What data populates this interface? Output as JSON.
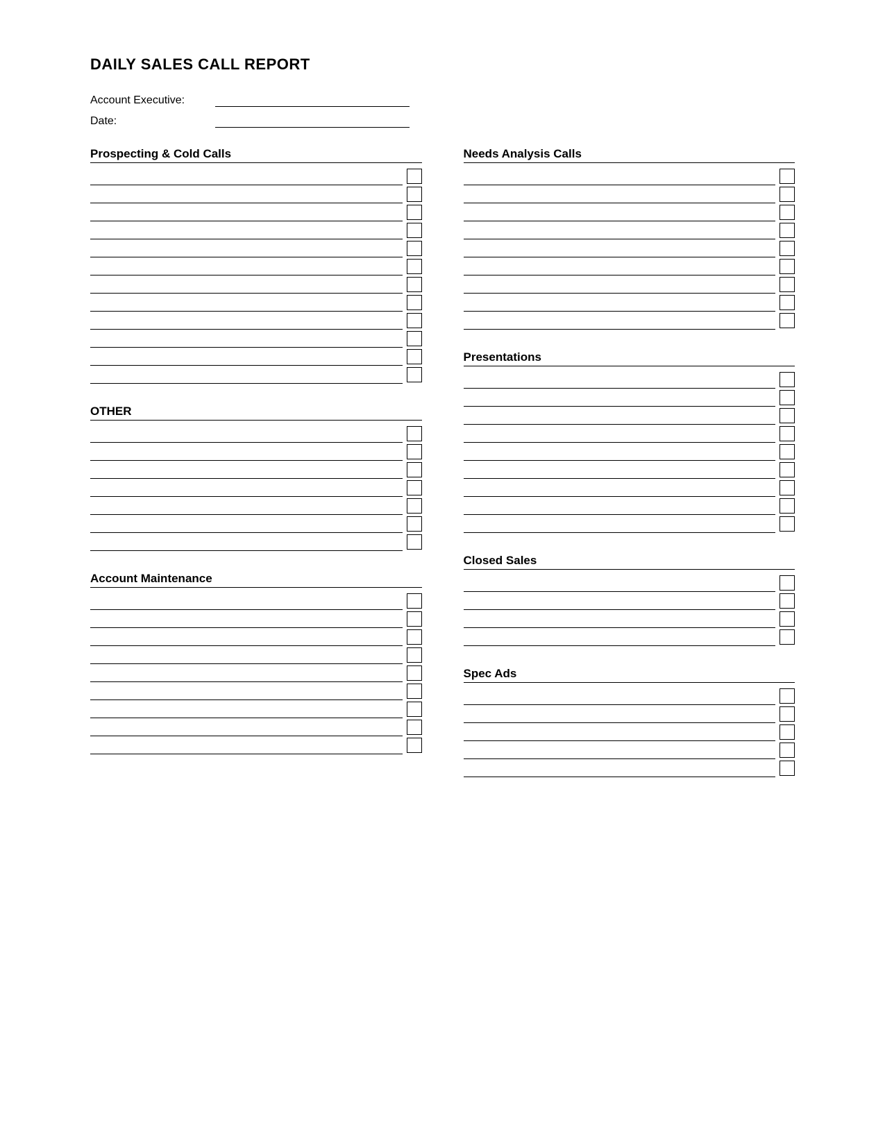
{
  "page": {
    "title": "DAILY SALES CALL REPORT",
    "fields": {
      "account_executive_label": "Account Executive:",
      "date_label": "Date:"
    },
    "sections": {
      "prospecting": {
        "title": "Prospecting & Cold Calls",
        "rows": 12
      },
      "other": {
        "title": "OTHER",
        "rows": 7
      },
      "needs_analysis": {
        "title": "Needs Analysis Calls",
        "rows": 9
      },
      "presentations": {
        "title": "Presentations",
        "rows": 9
      },
      "account_maintenance": {
        "title": "Account Maintenance",
        "rows": 9
      },
      "closed_sales": {
        "title": "Closed Sales",
        "rows": 4
      },
      "spec_ads": {
        "title": "Spec Ads",
        "rows": 5
      }
    }
  }
}
